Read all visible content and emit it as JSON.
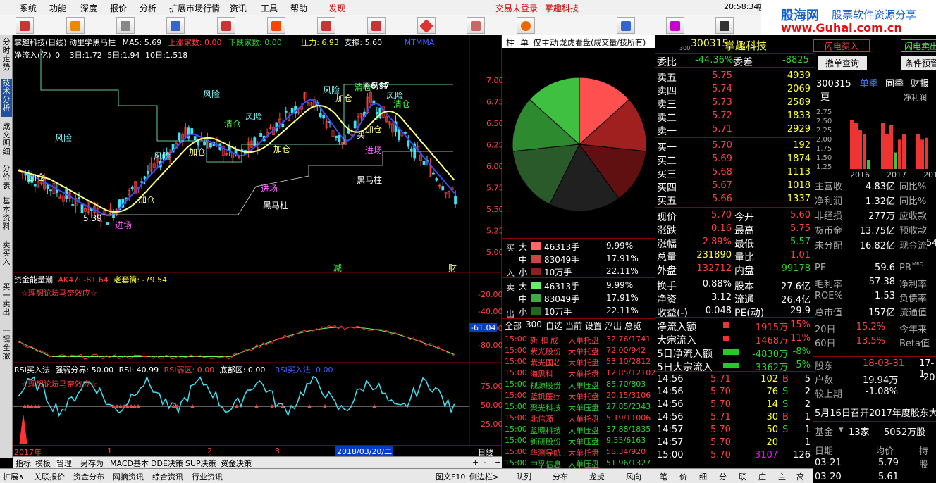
{
  "menu": [
    "系统",
    "功能",
    "深度",
    "报价",
    "分析",
    "扩展市场行情",
    "资讯",
    "工具",
    "帮助",
    "发现"
  ],
  "status": {
    "login": "交易未登录",
    "stock": "掌趣科技",
    "time": "20:58:34",
    "weekday": "周六"
  },
  "logo": {
    "brand": "股海网",
    "slogan": "股票软件资源分享",
    "url": "www.Guhai.com.cn"
  },
  "toolbar_icons": [
    "trade-icon",
    "hot-icon",
    "settings-icon",
    "chart-icon",
    "list-icon",
    "fire-icon",
    "news-icon",
    "calendar-icon",
    "diamond-icon",
    "doc-icon",
    "hk-icon",
    "ipo-icon"
  ],
  "left_tabs": [
    "分时走势",
    "技术分析",
    "成交明细",
    "分价表",
    "基本资料",
    "卖买入",
    "买一卖出",
    "一键全撤"
  ],
  "chart": {
    "title": "掌趣科技(日线) 动里学黑马柱",
    "ma5": "MA5: 5.69",
    "up": "上涨家数: 0.00",
    "down": "下跌家数: 0.00",
    "resist": "压力: 6.93",
    "support": "支撑: 5.60",
    "mtmma": "MTMMA",
    "netin": "净流入(亿)",
    "periods": [
      "0",
      "3日:1.72",
      "5日:1.94",
      "10日:1.518"
    ],
    "yticks": [
      "7.00",
      "6.75",
      "6.50",
      "6.25",
      "6.00",
      "5.75",
      "5.50",
      "5.25",
      "5.00"
    ],
    "annotations": [
      "风险",
      "风险",
      "风险",
      "风险",
      "风险",
      "风险",
      "加仓",
      "加仓",
      "加仓",
      "加仓",
      "加仓",
      "加仓",
      "清仓",
      "清仓",
      "清仓",
      "买",
      "进场",
      "进场",
      "进场",
      "黑马柱",
      "黑马柱",
      "黑马柱",
      "6.97",
      "5.39",
      "减",
      "财"
    ]
  },
  "ind1": {
    "name": "资金能量潮",
    "ak": "AK47: -81.64",
    "old": "老套筒: -79.54",
    "forum": "☆理想论坛马奈效应☆",
    "yticks": [
      "-20.00",
      "-40.00",
      "-60.00",
      "-80.00"
    ],
    "current": "-61.04"
  },
  "ind2": {
    "name": "RSI买入法",
    "strong": "强弱分界: 50.00",
    "rsi": "RSI: 40.99",
    "weak": "RSI弱区: 0.00",
    "bottom": "底部区: 0.00",
    "buy": "RSI买入法: 0.00",
    "forum": "☆理想论坛马奈效应☆",
    "yticks": [
      "75.00",
      "50.00",
      "25.00"
    ]
  },
  "xaxis": {
    "year": "2017年",
    "m1": "1",
    "m2": "2",
    "m3": "3",
    "date": "2018/03/20/二",
    "period": "日线"
  },
  "bottom_tabs1": [
    "指标",
    "模板",
    "管理",
    "另存为",
    "MACD基本",
    "DDE决策",
    "SUP决策",
    "资金决策"
  ],
  "bottom_tabs2": [
    "扩展∧",
    "关联报价",
    "资金分布",
    "网摘资讯",
    "综合资讯",
    "行业资讯",
    "图文F10",
    "侧边栏>"
  ],
  "pie_tabs": [
    "柱",
    "单",
    "仅主动",
    "龙虎看盘(成交量/技所有)"
  ],
  "pie_colors": [
    "#ff5050",
    "#a02020",
    "#601010",
    "#202020",
    "#2a5a2a",
    "#2e8a2e",
    "#40c040"
  ],
  "flow": {
    "buy": [
      {
        "size": "大",
        "amt": "46313手",
        "pct": "9.99%"
      },
      {
        "size": "中",
        "amt": "83049手",
        "pct": "17.91%"
      },
      {
        "size": "小",
        "amt": "10万手",
        "pct": "22.11%"
      }
    ],
    "sell": [
      {
        "size": "大",
        "amt": "46313手",
        "pct": "9.99%"
      },
      {
        "size": "中",
        "amt": "83049手",
        "pct": "17.91%"
      },
      {
        "size": "小",
        "amt": "10万手",
        "pct": "22.11%"
      }
    ],
    "buylabel": [
      "买",
      "入"
    ],
    "selllabel": [
      "卖",
      "出"
    ]
  },
  "filter_tabs": [
    "全部",
    "300",
    "自选",
    "当前",
    "设置",
    "浮出",
    "总览"
  ],
  "monitor": [
    {
      "t": "15:00",
      "n": "新 和 成",
      "a": "大单托盘",
      "v": "32.76/1741",
      "c": "red"
    },
    {
      "t": "15:00",
      "n": "紫光股份",
      "a": "大单托盘",
      "v": "72.00/942",
      "c": "red"
    },
    {
      "t": "15:00",
      "n": "紫光国芯",
      "a": "大单托盘",
      "v": "53.10/2812",
      "c": "red"
    },
    {
      "t": "15:00",
      "n": "海思科",
      "a": "大单托盘",
      "v": "12.85/12102",
      "c": "red"
    },
    {
      "t": "15:00",
      "n": "视源股份",
      "a": "大单压盘",
      "v": "85.70/803",
      "c": "grn"
    },
    {
      "t": "15:00",
      "n": "蓝帆医疗",
      "a": "大单托盘",
      "v": "20.15/3106",
      "c": "red"
    },
    {
      "t": "15:00",
      "n": "聚光科技",
      "a": "大单压盘",
      "v": "27.85/2343",
      "c": "grn"
    },
    {
      "t": "15:00",
      "n": "北信源",
      "a": "大单托盘",
      "v": "5.19/11006",
      "c": "red"
    },
    {
      "t": "15:00",
      "n": "蓝晓科技",
      "a": "大单压盘",
      "v": "37.88/1835",
      "c": "grn"
    },
    {
      "t": "15:00",
      "n": "新研股份",
      "a": "大单压盘",
      "v": "9.55/6163",
      "c": "grn"
    },
    {
      "t": "15:00",
      "n": "华测导航",
      "a": "大单托盘",
      "v": "58.34/920",
      "c": "red"
    },
    {
      "t": "15:00",
      "n": "中孚信息",
      "a": "大单压盘",
      "v": "51.96/1327",
      "c": "grn"
    }
  ],
  "monitor_tabs": [
    "队列",
    "分布",
    "龙虎",
    "风向"
  ],
  "quote": {
    "code": "300315",
    "name": "掌趣科技",
    "prefix": "300",
    "weibi_l": "委比",
    "weibi": "-44.36%",
    "weicha_l": "委差",
    "weicha": "-8825",
    "sell": [
      {
        "l": "卖五",
        "p": "5.75",
        "v": "4939"
      },
      {
        "l": "卖四",
        "p": "5.74",
        "v": "2069"
      },
      {
        "l": "卖三",
        "p": "5.73",
        "v": "2589"
      },
      {
        "l": "卖二",
        "p": "5.72",
        "v": "1833"
      },
      {
        "l": "卖一",
        "p": "5.71",
        "v": "2929"
      }
    ],
    "buy": [
      {
        "l": "买一",
        "p": "5.70",
        "v": "192"
      },
      {
        "l": "买二",
        "p": "5.69",
        "v": "1874"
      },
      {
        "l": "买三",
        "p": "5.68",
        "v": "1113"
      },
      {
        "l": "买四",
        "p": "5.67",
        "v": "1018"
      },
      {
        "l": "买五",
        "p": "5.66",
        "v": "1337"
      }
    ],
    "stats": [
      [
        "现价",
        "5.70",
        "今开",
        "5.60"
      ],
      [
        "涨跌",
        "0.16",
        "最高",
        "5.75"
      ],
      [
        "涨幅",
        "2.89%",
        "最低",
        "5.57"
      ],
      [
        "总量",
        "231890",
        "量比",
        "1.01"
      ],
      [
        "外盘",
        "132712",
        "内盘",
        "99178"
      ],
      [
        "换手",
        "0.88%",
        "股本",
        "27.6亿"
      ],
      [
        "净资",
        "3.12",
        "流通",
        "26.4亿"
      ],
      [
        "收益(-)",
        "0.048",
        "PE(动)",
        "29.9"
      ]
    ],
    "flows": [
      {
        "l": "净流入额",
        "v": "1915万",
        "p": "15%",
        "c": "red"
      },
      {
        "l": "大宗流入",
        "v": "1468万",
        "p": "11%",
        "c": "red"
      },
      {
        "l": "5日净流入额",
        "v": "-4830万",
        "p": "-8%",
        "c": "grn"
      },
      {
        "l": "5日大宗流入",
        "v": "-3362万",
        "p": "-5%",
        "c": "grn"
      }
    ],
    "ticks": [
      {
        "t": "14:56",
        "p": "5.71",
        "v": "102",
        "d": "B",
        "n": "5"
      },
      {
        "t": "14:56",
        "p": "5.70",
        "v": "76",
        "d": "S",
        "n": "2"
      },
      {
        "t": "14:56",
        "p": "5.70",
        "v": "14",
        "d": "S",
        "n": "2"
      },
      {
        "t": "14:56",
        "p": "5.71",
        "v": "30",
        "d": "B",
        "n": "1"
      },
      {
        "t": "14:57",
        "p": "5.70",
        "v": "50",
        "d": "S",
        "n": "1"
      },
      {
        "t": "14:57",
        "p": "5.70",
        "v": "20",
        "d": "",
        "n": "1"
      },
      {
        "t": "15:00",
        "p": "5.70",
        "v": "3107",
        "d": "",
        "n": "126"
      }
    ],
    "bottom_tabs": [
      "笔",
      "价",
      "细",
      "分",
      "联",
      "庄",
      "主",
      "高"
    ]
  },
  "fin": {
    "btn1": "闪电买入",
    "btn2": "闪电卖出",
    "btn3": "撤单查询",
    "btn4": "条件预警",
    "code": "300315",
    "tabs": [
      "单季",
      "同季",
      "财报",
      "更"
    ],
    "chart_label": "净利润",
    "yticks": [
      "2.75",
      "2.50",
      "2.25",
      "2.00",
      "1.75",
      "1.50",
      "1.25"
    ],
    "years": [
      "2016",
      "2017",
      "201"
    ],
    "rows": [
      [
        "主营收",
        "4.83亿",
        "同比%",
        ""
      ],
      [
        "净利润",
        "1.32亿",
        "同比%",
        ""
      ],
      [
        "非经损",
        "277万",
        "应收款",
        ""
      ],
      [
        "货币金",
        "13.75亿",
        "预收款",
        ""
      ],
      [
        "未分配",
        "16.82亿",
        "现金流",
        "54"
      ]
    ],
    "rows2": [
      [
        "PE",
        "59.6",
        "PB",
        "MRQ"
      ],
      [
        "毛利率",
        "57.38",
        "净利率",
        ""
      ],
      [
        "ROE%",
        "1.53",
        "负债率",
        ""
      ],
      [
        "总市值",
        "157亿",
        "流通值",
        ""
      ]
    ],
    "r20": [
      "20日",
      "-15.2%",
      "今年来"
    ],
    "r60": [
      "60日",
      "-13.5%",
      "Beta值"
    ],
    "holder": [
      "股东",
      "18-03-31",
      "17-1"
    ],
    "hu": [
      "户数",
      "19.94万",
      "20"
    ],
    "jiao": [
      "较上期",
      "-1.08%",
      ""
    ],
    "notice": "5月16日召开2017年度股东大",
    "fund": [
      "基金",
      "13家",
      "5052万股"
    ],
    "table_head": [
      "日期",
      "均价",
      "持股"
    ],
    "table_rows": [
      [
        "03-21",
        "5.79",
        ""
      ],
      [
        "03-20",
        "5.61",
        ""
      ]
    ]
  }
}
